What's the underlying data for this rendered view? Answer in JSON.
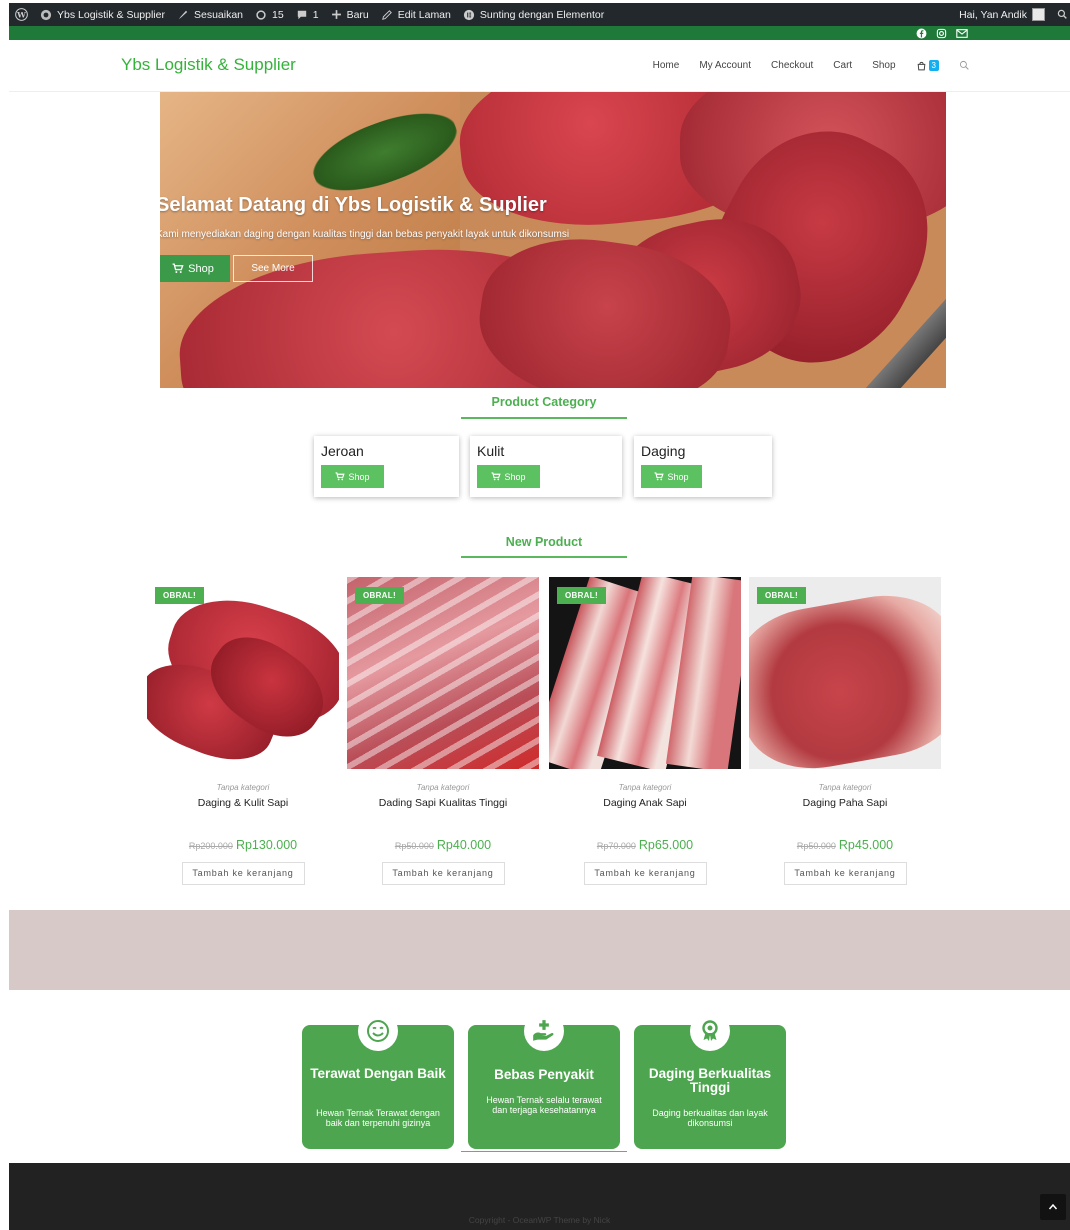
{
  "adminbar": {
    "site_name": "Ybs Logistik & Supplier",
    "customize": "Sesuaikan",
    "updates": "15",
    "comments": "1",
    "new": "Baru",
    "edit_page": "Edit Laman",
    "elementor": "Sunting dengan Elementor",
    "greeting": "Hai, Yan Andik"
  },
  "header": {
    "logo": "Ybs Logistik & Supplier",
    "nav": [
      "Home",
      "My Account",
      "Checkout",
      "Cart",
      "Shop"
    ],
    "cart_count": "3",
    "icons": {
      "cart": "shopping-bag-icon",
      "search": "search-icon",
      "social": [
        "facebook-icon",
        "instagram-icon",
        "mail-icon"
      ]
    }
  },
  "hero": {
    "title": "Selamat Datang di Ybs Logistik & Suplier",
    "subtitle": "Kami menyediakan daging dengan kualitas tinggi dan bebas penyakit layak untuk dikonsumsi",
    "shop_button": "Shop",
    "more_button": "See More"
  },
  "categories": {
    "heading": "Product Category",
    "items": [
      {
        "name": "Jeroan",
        "button": "Shop"
      },
      {
        "name": "Kulit",
        "button": "Shop"
      },
      {
        "name": "Daging",
        "button": "Shop"
      }
    ]
  },
  "products": {
    "heading": "New Product",
    "items": [
      {
        "badge": "OBRAL!",
        "category": "Tanpa kategori",
        "name": "Daging & Kulit Sapi",
        "old_price": "Rp200.000",
        "price": "Rp130.000",
        "button": "Tambah ke keranjang"
      },
      {
        "badge": "OBRAL!",
        "category": "Tanpa kategori",
        "name": "Dading Sapi Kualitas Tinggi",
        "old_price": "Rp50.000",
        "price": "Rp40.000",
        "button": "Tambah ke keranjang"
      },
      {
        "badge": "OBRAL!",
        "category": "Tanpa kategori",
        "name": "Daging Anak Sapi",
        "old_price": "Rp70.000",
        "price": "Rp65.000",
        "button": "Tambah ke keranjang"
      },
      {
        "badge": "OBRAL!",
        "category": "Tanpa kategori",
        "name": "Daging Paha Sapi",
        "old_price": "Rp50.000",
        "price": "Rp45.000",
        "button": "Tambah ke keranjang"
      }
    ]
  },
  "features": [
    {
      "icon": "smile-icon",
      "title": "Terawat Dengan Baik",
      "desc": "Hewan Ternak Terawat dengan baik dan terpenuhi gizinya"
    },
    {
      "icon": "hand-plus-icon",
      "title": "Bebas Penyakit",
      "desc": "Hewan Ternak selalu terawat dan terjaga kesehatannya"
    },
    {
      "icon": "award-icon",
      "title": "Daging Berkualitas Tinggi",
      "desc": "Daging berkualitas dan layak dikonsumsi"
    }
  ],
  "footer": {
    "copyright": "Copyright - OceanWP Theme by Nick"
  },
  "colors": {
    "brand_green": "#4caf50",
    "logo_green": "#34b33a",
    "adminbar": "#23282d",
    "band": "#d8c9c9",
    "footer": "#222222"
  }
}
